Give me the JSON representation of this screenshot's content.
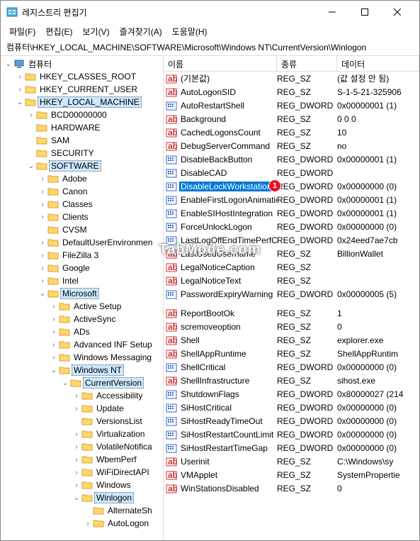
{
  "window": {
    "title": "레지스트리 편집기"
  },
  "menu": {
    "file": "파일(F)",
    "edit": "편집(E)",
    "view": "보기(V)",
    "favorites": "즐겨찾기(A)",
    "help": "도움말(H)"
  },
  "path": "컴퓨터\\HKEY_LOCAL_MACHINE\\SOFTWARE\\Microsoft\\Windows NT\\CurrentVersion\\Winlogon",
  "columns": {
    "name": "이름",
    "type": "종류",
    "data": "데이터"
  },
  "tree": [
    {
      "indent": 0,
      "expanded": true,
      "icon": "pc",
      "label": "컴퓨터",
      "sel": false
    },
    {
      "indent": 1,
      "expanded": false,
      "icon": "folder",
      "label": "HKEY_CLASSES_ROOT"
    },
    {
      "indent": 1,
      "expanded": false,
      "icon": "folder",
      "label": "HKEY_CURRENT_USER"
    },
    {
      "indent": 1,
      "expanded": true,
      "icon": "folder",
      "label": "HKEY_LOCAL_MACHINE",
      "sel": true
    },
    {
      "indent": 2,
      "expanded": false,
      "icon": "folder",
      "label": "BCD00000000"
    },
    {
      "indent": 2,
      "expanded": null,
      "icon": "folder",
      "label": "HARDWARE"
    },
    {
      "indent": 2,
      "expanded": null,
      "icon": "folder",
      "label": "SAM"
    },
    {
      "indent": 2,
      "expanded": null,
      "icon": "folder",
      "label": "SECURITY"
    },
    {
      "indent": 2,
      "expanded": true,
      "icon": "folder",
      "label": "SOFTWARE",
      "sel": true
    },
    {
      "indent": 3,
      "expanded": false,
      "icon": "folder",
      "label": "Adobe"
    },
    {
      "indent": 3,
      "expanded": false,
      "icon": "folder",
      "label": "Canon"
    },
    {
      "indent": 3,
      "expanded": false,
      "icon": "folder",
      "label": "Classes"
    },
    {
      "indent": 3,
      "expanded": false,
      "icon": "folder",
      "label": "Clients"
    },
    {
      "indent": 3,
      "expanded": null,
      "icon": "folder",
      "label": "CVSM"
    },
    {
      "indent": 3,
      "expanded": false,
      "icon": "folder",
      "label": "DefaultUserEnvironmen"
    },
    {
      "indent": 3,
      "expanded": false,
      "icon": "folder",
      "label": "FileZilla 3"
    },
    {
      "indent": 3,
      "expanded": false,
      "icon": "folder",
      "label": "Google"
    },
    {
      "indent": 3,
      "expanded": false,
      "icon": "folder",
      "label": "Intel"
    },
    {
      "indent": 3,
      "expanded": true,
      "icon": "folder",
      "label": "Microsoft",
      "sel": true
    },
    {
      "indent": 4,
      "expanded": false,
      "icon": "folder",
      "label": "Active Setup"
    },
    {
      "indent": 4,
      "expanded": false,
      "icon": "folder",
      "label": "ActiveSync"
    },
    {
      "indent": 4,
      "expanded": false,
      "icon": "folder",
      "label": "ADs"
    },
    {
      "indent": 4,
      "expanded": false,
      "icon": "folder",
      "label": "Advanced INF Setup"
    },
    {
      "indent": 4,
      "expanded": false,
      "icon": "folder",
      "label": "Windows Messaging"
    },
    {
      "indent": 4,
      "expanded": true,
      "icon": "folder",
      "label": "Windows NT",
      "sel": true
    },
    {
      "indent": 5,
      "expanded": true,
      "icon": "folder",
      "label": "CurrentVersion",
      "sel": true
    },
    {
      "indent": 6,
      "expanded": false,
      "icon": "folder",
      "label": "Accessibility"
    },
    {
      "indent": 6,
      "expanded": false,
      "icon": "folder",
      "label": "Update"
    },
    {
      "indent": 6,
      "expanded": null,
      "icon": "folder",
      "label": "VersionsList"
    },
    {
      "indent": 6,
      "expanded": false,
      "icon": "folder",
      "label": "Virtualization"
    },
    {
      "indent": 6,
      "expanded": false,
      "icon": "folder",
      "label": "VolatileNotifica"
    },
    {
      "indent": 6,
      "expanded": false,
      "icon": "folder",
      "label": "WbemPerf"
    },
    {
      "indent": 6,
      "expanded": false,
      "icon": "folder",
      "label": "WiFiDirectAPI"
    },
    {
      "indent": 6,
      "expanded": false,
      "icon": "folder",
      "label": "Windows"
    },
    {
      "indent": 6,
      "expanded": true,
      "icon": "folder",
      "label": "Winlogon",
      "sel": true
    },
    {
      "indent": 7,
      "expanded": null,
      "icon": "folder",
      "label": "AlternateSh"
    },
    {
      "indent": 7,
      "expanded": false,
      "icon": "folder",
      "label": "AutoLogon"
    }
  ],
  "values": [
    {
      "icon": "sz",
      "name": "(기본값)",
      "type": "REG_SZ",
      "data": "(값 설정 안 됨)"
    },
    {
      "icon": "sz",
      "name": "AutoLogonSID",
      "type": "REG_SZ",
      "data": "S-1-5-21-325906"
    },
    {
      "icon": "dw",
      "name": "AutoRestartShell",
      "type": "REG_DWORD",
      "data": "0x00000001 (1)"
    },
    {
      "icon": "sz",
      "name": "Background",
      "type": "REG_SZ",
      "data": "0 0 0"
    },
    {
      "icon": "sz",
      "name": "CachedLogonsCount",
      "type": "REG_SZ",
      "data": "10"
    },
    {
      "icon": "sz",
      "name": "DebugServerCommand",
      "type": "REG_SZ",
      "data": "no"
    },
    {
      "icon": "dw",
      "name": "DisableBackButton",
      "type": "REG_DWORD",
      "data": "0x00000001 (1)"
    },
    {
      "icon": "dw",
      "name": "DisableCAD",
      "type": "REG_DWORD",
      "data": ""
    },
    {
      "icon": "dw",
      "name": "DisableLockWorkstation",
      "type": "REG_DWORD",
      "data": "0x00000000 (0)",
      "sel": true,
      "badge": "1"
    },
    {
      "icon": "dw",
      "name": "EnableFirstLogonAnimation",
      "type": "REG_DWORD",
      "data": "0x00000001 (1)"
    },
    {
      "icon": "dw",
      "name": "EnableSIHostIntegration",
      "type": "REG_DWORD",
      "data": "0x00000001 (1)"
    },
    {
      "icon": "dw",
      "name": "ForceUnlockLogon",
      "type": "REG_DWORD",
      "data": "0x00000000 (0)"
    },
    {
      "icon": "dw",
      "name": "LastLogOffEndTimePerfCo...",
      "type": "REG_DWORD",
      "data": "0x24eed7ae7cb"
    },
    {
      "icon": "sz",
      "name": "LastUsedUsername",
      "type": "REG_SZ",
      "data": "BillionWallet"
    },
    {
      "icon": "sz",
      "name": "LegalNoticeCaption",
      "type": "REG_SZ",
      "data": ""
    },
    {
      "icon": "sz",
      "name": "LegalNoticeText",
      "type": "REG_SZ",
      "data": ""
    },
    {
      "icon": "dw",
      "name": "PasswordExpiryWarning",
      "type": "REG_DWORD",
      "data": "0x00000005 (5)"
    },
    {
      "icon": "sz",
      "name": "ReportBootOk",
      "type": "REG_SZ",
      "data": "1"
    },
    {
      "icon": "sz",
      "name": "scremoveoption",
      "type": "REG_SZ",
      "data": "0"
    },
    {
      "icon": "sz",
      "name": "Shell",
      "type": "REG_SZ",
      "data": "explorer.exe"
    },
    {
      "icon": "sz",
      "name": "ShellAppRuntime",
      "type": "REG_SZ",
      "data": "ShellAppRuntim"
    },
    {
      "icon": "dw",
      "name": "ShellCritical",
      "type": "REG_DWORD",
      "data": "0x00000000 (0)"
    },
    {
      "icon": "sz",
      "name": "ShellInfrastructure",
      "type": "REG_SZ",
      "data": "sihost.exe"
    },
    {
      "icon": "dw",
      "name": "ShutdownFlags",
      "type": "REG_DWORD",
      "data": "0x80000027 (214"
    },
    {
      "icon": "dw",
      "name": "SiHostCritical",
      "type": "REG_DWORD",
      "data": "0x00000000 (0)"
    },
    {
      "icon": "dw",
      "name": "SiHostReadyTimeOut",
      "type": "REG_DWORD",
      "data": "0x00000000 (0)"
    },
    {
      "icon": "dw",
      "name": "SiHostRestartCountLimit",
      "type": "REG_DWORD",
      "data": "0x00000000 (0)"
    },
    {
      "icon": "dw",
      "name": "SiHostRestartTimeGap",
      "type": "REG_DWORD",
      "data": "0x00000000 (0)"
    },
    {
      "icon": "sz",
      "name": "Userinit",
      "type": "REG_SZ",
      "data": "C:\\Windows\\sy"
    },
    {
      "icon": "sz",
      "name": "VMApplet",
      "type": "REG_SZ",
      "data": "SystemPropertie"
    },
    {
      "icon": "sz",
      "name": "WinStationsDisabled",
      "type": "REG_SZ",
      "data": "0"
    }
  ],
  "watermark": "TabMode.com"
}
